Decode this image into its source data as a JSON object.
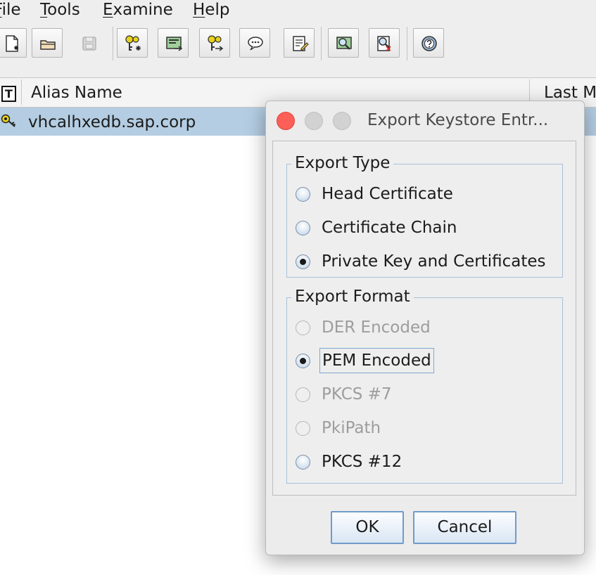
{
  "menu": {
    "items": [
      {
        "label_mnemonic": "F",
        "label_rest": "ile"
      },
      {
        "label_mnemonic": "T",
        "label_rest": "ools"
      },
      {
        "label_mnemonic": "E",
        "label_rest": "xamine"
      },
      {
        "label_mnemonic": "H",
        "label_rest": "elp"
      }
    ]
  },
  "toolbar": {
    "buttons": [
      "new-keystore-icon",
      "open-keystore-icon",
      "save-keystore-icon",
      "generate-key-pair-icon",
      "generate-certificate-icon",
      "import-key-pair-icon",
      "import-trusted-cert-icon",
      "keystore-properties-icon",
      "examine-certificate-icon",
      "examine-crl-icon",
      "help-icon"
    ]
  },
  "table": {
    "type_header": "T",
    "headers": [
      "Alias Name",
      "Last M"
    ],
    "rows": [
      {
        "alias": "vhcalhxedb.sap.corp",
        "type_icon": "key-pair-icon"
      }
    ]
  },
  "dialog": {
    "title": "Export Keystore Entr...",
    "export_type": {
      "title": "Export Type",
      "options": [
        {
          "label": "Head Certificate",
          "selected": false,
          "enabled": true
        },
        {
          "label": "Certificate Chain",
          "selected": false,
          "enabled": true
        },
        {
          "label": "Private Key and Certificates",
          "selected": true,
          "enabled": true
        }
      ]
    },
    "export_format": {
      "title": "Export Format",
      "options": [
        {
          "label": "DER Encoded",
          "selected": false,
          "enabled": false
        },
        {
          "label": "PEM Encoded",
          "selected": true,
          "enabled": true
        },
        {
          "label": "PKCS #7",
          "selected": false,
          "enabled": false
        },
        {
          "label": "PkiPath",
          "selected": false,
          "enabled": false
        },
        {
          "label": "PKCS #12",
          "selected": false,
          "enabled": true
        }
      ]
    },
    "ok_label": "OK",
    "cancel_label": "Cancel"
  },
  "colors": {
    "selection_row": "#b4cde2",
    "close_button": "#fc5f57",
    "focus_border": "#6f9bcb"
  }
}
